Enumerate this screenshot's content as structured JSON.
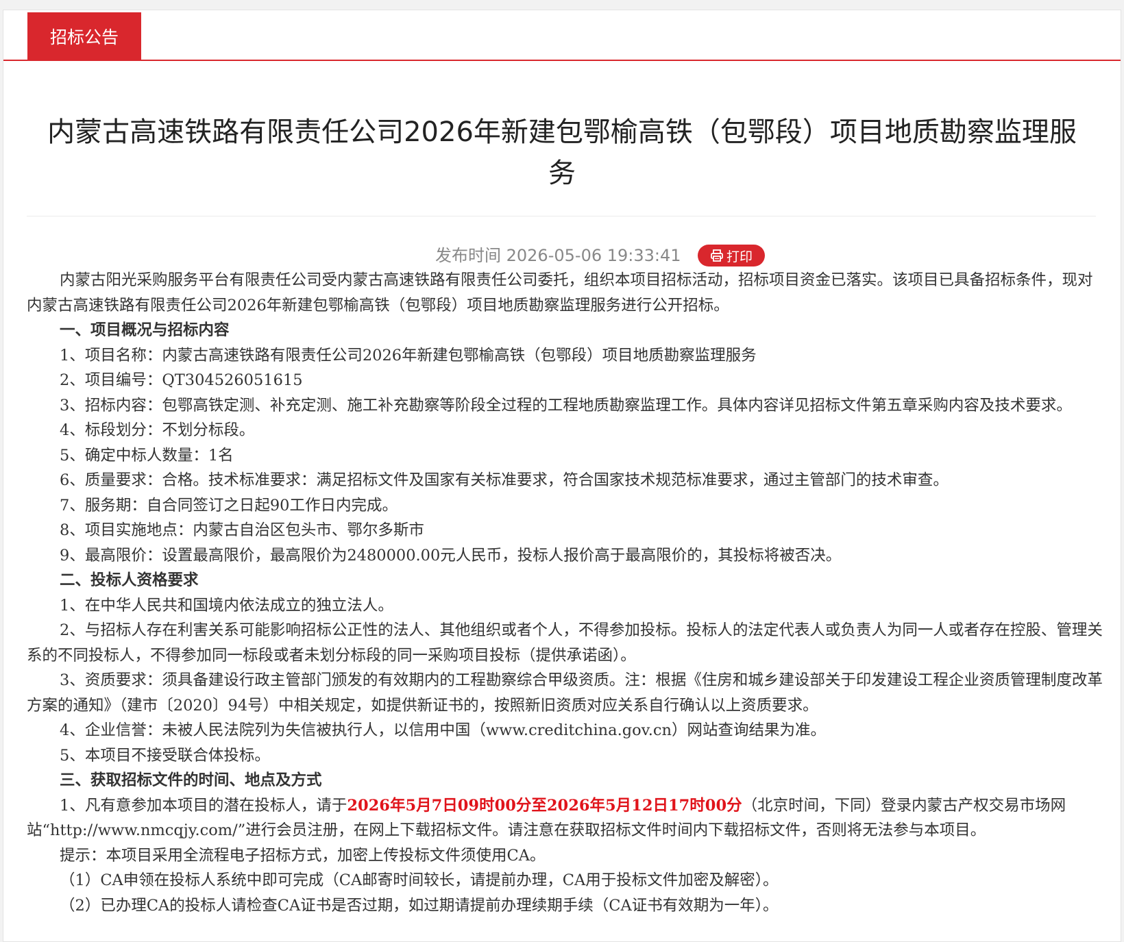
{
  "tab": {
    "label": "招标公告"
  },
  "title": "内蒙古高速铁路有限责任公司2026年新建包鄂榆高铁（包鄂段）项目地质勘察监理服务",
  "meta": {
    "publish_time": "发布时间 2026-05-06 19:33:41",
    "print_label": "打印"
  },
  "colors": {
    "accent": "#d9272d",
    "highlight": "#e0141b"
  },
  "paragraphs": [
    {
      "text": "内蒙古阳光采购服务平台有限责任公司受内蒙古高速铁路有限责任公司委托，组织本项目招标活动，招标项目资金已落实。该项目已具备招标条件，现对内蒙古高速铁路有限责任公司2026年新建包鄂榆高铁（包鄂段）项目地质勘察监理服务进行公开招标。"
    },
    {
      "text": "一、项目概况与招标内容"
    },
    {
      "text": "1、项目名称：内蒙古高速铁路有限责任公司2026年新建包鄂榆高铁（包鄂段）项目地质勘察监理服务"
    },
    {
      "text": "2、项目编号：QT304526051615"
    },
    {
      "text": "3、招标内容：包鄂高铁定测、补充定测、施工补充勘察等阶段全过程的工程地质勘察监理工作。具体内容详见招标文件第五章采购内容及技术要求。"
    },
    {
      "text": "4、标段划分：不划分标段。"
    },
    {
      "text": "5、确定中标人数量：1名"
    },
    {
      "text": "6、质量要求：合格。技术标准要求：满足招标文件及国家有关标准要求，符合国家技术规范标准要求，通过主管部门的技术审查。"
    },
    {
      "text": "7、服务期：自合同签订之日起90工作日内完成。"
    },
    {
      "text": "8、项目实施地点：内蒙古自治区包头市、鄂尔多斯市"
    },
    {
      "text": "9、最高限价：设置最高限价，最高限价为2480000.00元人民币，投标人报价高于最高限价的，其投标将被否决。"
    },
    {
      "text": "二、投标人资格要求"
    },
    {
      "text": "1、在中华人民共和国境内依法成立的独立法人。"
    },
    {
      "text": "2、与招标人存在利害关系可能影响招标公正性的法人、其他组织或者个人，不得参加投标。投标人的法定代表人或负责人为同一人或者存在控股、管理关系的不同投标人，不得参加同一标段或者未划分标段的同一采购项目投标（提供承诺函）。"
    },
    {
      "text": "3、资质要求：须具备建设行政主管部门颁发的有效期内的工程勘察综合甲级资质。注：根据《住房和城乡建设部关于印发建设工程企业资质管理制度改革方案的通知》（建市〔2020〕94号）中相关规定，如提供新证书的，按照新旧资质对应关系自行确认以上资质要求。"
    },
    {
      "text": "4、企业信誉：未被人民法院列为失信被执行人，以信用中国（www.creditchina.gov.cn）网站查询结果为准。"
    },
    {
      "text": "5、本项目不接受联合体投标。"
    },
    {
      "text": "三、获取招标文件的时间、地点及方式"
    },
    {
      "pre": "1、凡有意参加本项目的潜在投标人，请于",
      "highlight": "2026年5月7日09时00分至2026年5月12日17时00分",
      "post": "（北京时间，下同）登录内蒙古产权交易市场网站“http://www.nmcqjy.com/”进行会员注册，在网上下载招标文件。请注意在获取招标文件时间内下载招标文件，否则将无法参与本项目。"
    },
    {
      "text": "提示：本项目采用全流程电子招标方式，加密上传投标文件须使用CA。"
    },
    {
      "text": "（1）CA申领在投标人系统中即可完成（CA邮寄时间较长，请提前办理，CA用于投标文件加密及解密）。"
    },
    {
      "text": "（2）已办理CA的投标人请检查CA证书是否过期，如过期请提前办理续期手续（CA证书有效期为一年）。"
    }
  ]
}
